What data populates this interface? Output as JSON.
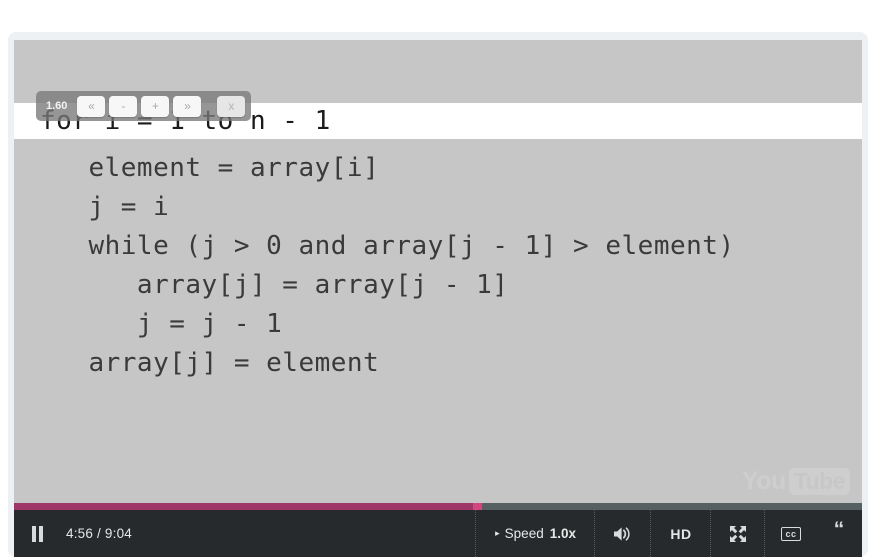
{
  "player": {
    "slide": {
      "code_lines": [
        "for i = 1 to n - 1",
        "   element = array[i]",
        "   j = i",
        "   while (j > 0 and array[j - 1] > element)",
        "      array[j] = array[j - 1]",
        "      j = j - 1",
        "   array[j] = element"
      ],
      "background_color": "#c6c6c6",
      "highlight_color": "#ffffff",
      "text_color": "#3a3a3a"
    },
    "speed_widget": {
      "value": "1.60",
      "buttons": [
        {
          "name": "rewind-much",
          "label": "«"
        },
        {
          "name": "decrease",
          "label": "-"
        },
        {
          "name": "increase",
          "label": "+"
        },
        {
          "name": "forward-much",
          "label": "»"
        }
      ],
      "close_label": "x"
    },
    "watermark": {
      "you": "You",
      "tube": "Tube"
    },
    "progress": {
      "percent": 54.6,
      "fill_color": "#9e3767",
      "handle_color": "#d6447f",
      "track_color": "#566063"
    },
    "controls": {
      "pause_name": "pause",
      "time": "4:56 / 9:04",
      "current_time": "4:56",
      "duration": "9:04",
      "speed_caret": "▸",
      "speed_label": "Speed",
      "speed_value": "1.0x",
      "volume_name": "volume",
      "hd_label": "HD",
      "fullscreen_name": "fullscreen",
      "cc_label": "cc",
      "transcript_label": "“",
      "bar_color": "#262a2d"
    }
  }
}
